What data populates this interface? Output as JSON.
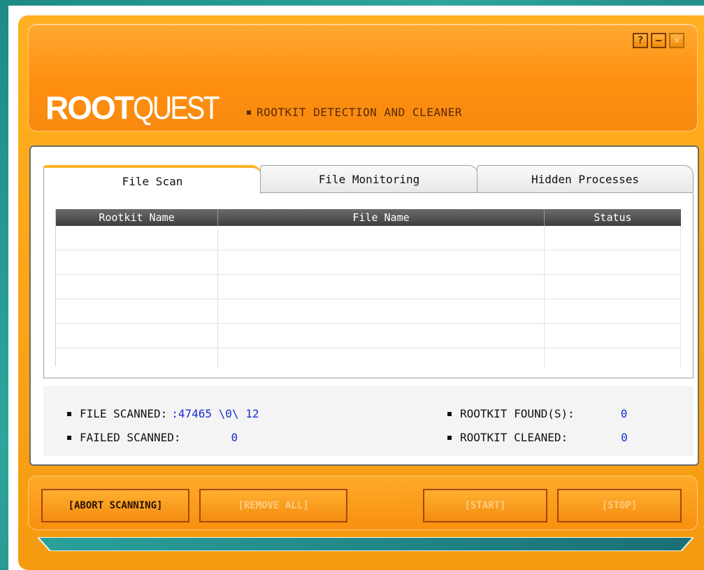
{
  "window": {
    "controls": {
      "help": "?",
      "minimize": "–",
      "close": "×"
    },
    "logo": {
      "bold": "ROOT",
      "light": "QUEST"
    },
    "subtitle": "ROOTKIT DETECTION AND CLEANER"
  },
  "tabs": [
    {
      "label": "File Scan",
      "active": true
    },
    {
      "label": "File Monitoring",
      "active": false
    },
    {
      "label": "Hidden Processes",
      "active": false
    }
  ],
  "table": {
    "columns": [
      "Rootkit Name",
      "File Name",
      "Status"
    ],
    "rows": []
  },
  "stats": {
    "file_scanned_label": "FILE SCANNED:",
    "file_scanned_value": ":47465 \\0\\ 12",
    "failed_scanned_label": "FAILED SCANNED:",
    "failed_scanned_value": "0",
    "rootkit_found_label": "ROOTKIT FOUND(S):",
    "rootkit_found_value": "0",
    "rootkit_cleaned_label": "ROOTKIT CLEANED:",
    "rootkit_cleaned_value": "0"
  },
  "buttons": {
    "abort": "[ABORT SCANNING]",
    "remove_all": "[REMOVE ALL]",
    "start": "[START]",
    "stop": "[STOP]"
  },
  "colors": {
    "accent": "#F7900F",
    "value_text": "#1A2FD0",
    "teal_background": "#1C8B86"
  }
}
